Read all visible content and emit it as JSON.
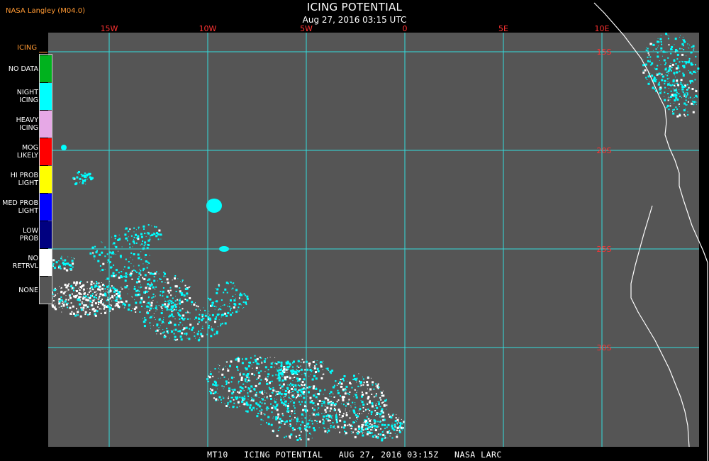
{
  "header": {
    "source": "NASA Langley (M04.0)",
    "title": "ICING POTENTIAL",
    "datetime": "Aug 27, 2016 03:15 UTC"
  },
  "legend": {
    "title": "ICING",
    "items": [
      {
        "label": "NO DATA",
        "color": "#00b21e"
      },
      {
        "label": "NIGHT\nICING",
        "color": "#00ffff"
      },
      {
        "label": "HEAVY\nICING",
        "color": "#e6a8e6"
      },
      {
        "label": "MOG\nLIKELY",
        "color": "#ff0000"
      },
      {
        "label": "HI PROB\nLIGHT",
        "color": "#ffff00"
      },
      {
        "label": "MED PROB\nLIGHT",
        "color": "#0000ff"
      },
      {
        "label": "LOW\nPROB",
        "color": "#000080"
      },
      {
        "label": "NO\nRETRVL",
        "color": "#ffffff"
      },
      {
        "label": "NONE",
        "color": "#555555"
      }
    ]
  },
  "map": {
    "background_color": "#555555",
    "grid_color": "#33dddd",
    "lon_labels": [
      {
        "text": "15W",
        "lon": -15
      },
      {
        "text": "10W",
        "lon": -10
      },
      {
        "text": "5W",
        "lon": -5
      },
      {
        "text": "0",
        "lon": 0
      },
      {
        "text": "5E",
        "lon": 5
      },
      {
        "text": "10E",
        "lon": 10
      }
    ],
    "lat_labels": [
      {
        "text": "15S",
        "lat": -15
      },
      {
        "text": "20S",
        "lat": -20
      },
      {
        "text": "25S",
        "lat": -25
      },
      {
        "text": "30S",
        "lat": -30
      }
    ],
    "coast_color": "#ffffff",
    "icing_color": "#00ffff",
    "no_retrieval_color": "#ffffff"
  },
  "footer": "MT10   ICING POTENTIAL   AUG 27, 2016 03:15Z   NASA LARC"
}
